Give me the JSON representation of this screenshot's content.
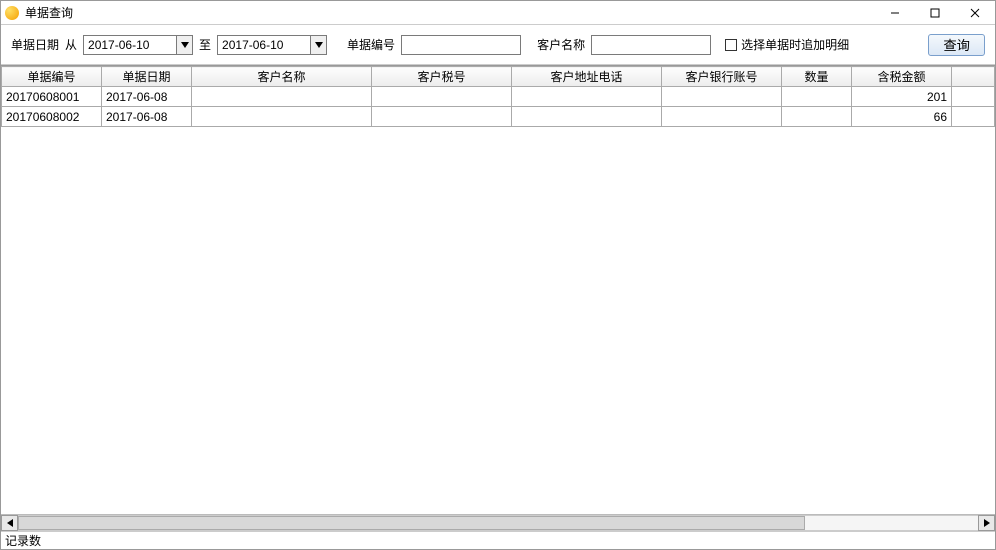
{
  "window": {
    "title": "单据查询"
  },
  "filter": {
    "date_label": "单据日期",
    "from_label": "从",
    "from_value": "2017-06-10",
    "to_label": "至",
    "to_value": "2017-06-10",
    "doc_no_label": "单据编号",
    "doc_no_value": "",
    "customer_label": "客户名称",
    "customer_value": "",
    "checkbox_label": "选择单据时追加明细",
    "checkbox_checked": false,
    "query_button": "查询"
  },
  "table": {
    "headers": [
      "单据编号",
      "单据日期",
      "客户名称",
      "客户税号",
      "客户地址电话",
      "客户银行账号",
      "数量",
      "含税金额"
    ],
    "rows": [
      {
        "doc_no": "20170608001",
        "doc_date": "2017-06-08",
        "customer": "",
        "tax_no": "",
        "addr_tel": "",
        "bank": "",
        "qty": "",
        "amount": "201"
      },
      {
        "doc_no": "20170608002",
        "doc_date": "2017-06-08",
        "customer": "",
        "tax_no": "",
        "addr_tel": "",
        "bank": "",
        "qty": "",
        "amount": "66"
      }
    ]
  },
  "status": {
    "label": "记录数"
  }
}
